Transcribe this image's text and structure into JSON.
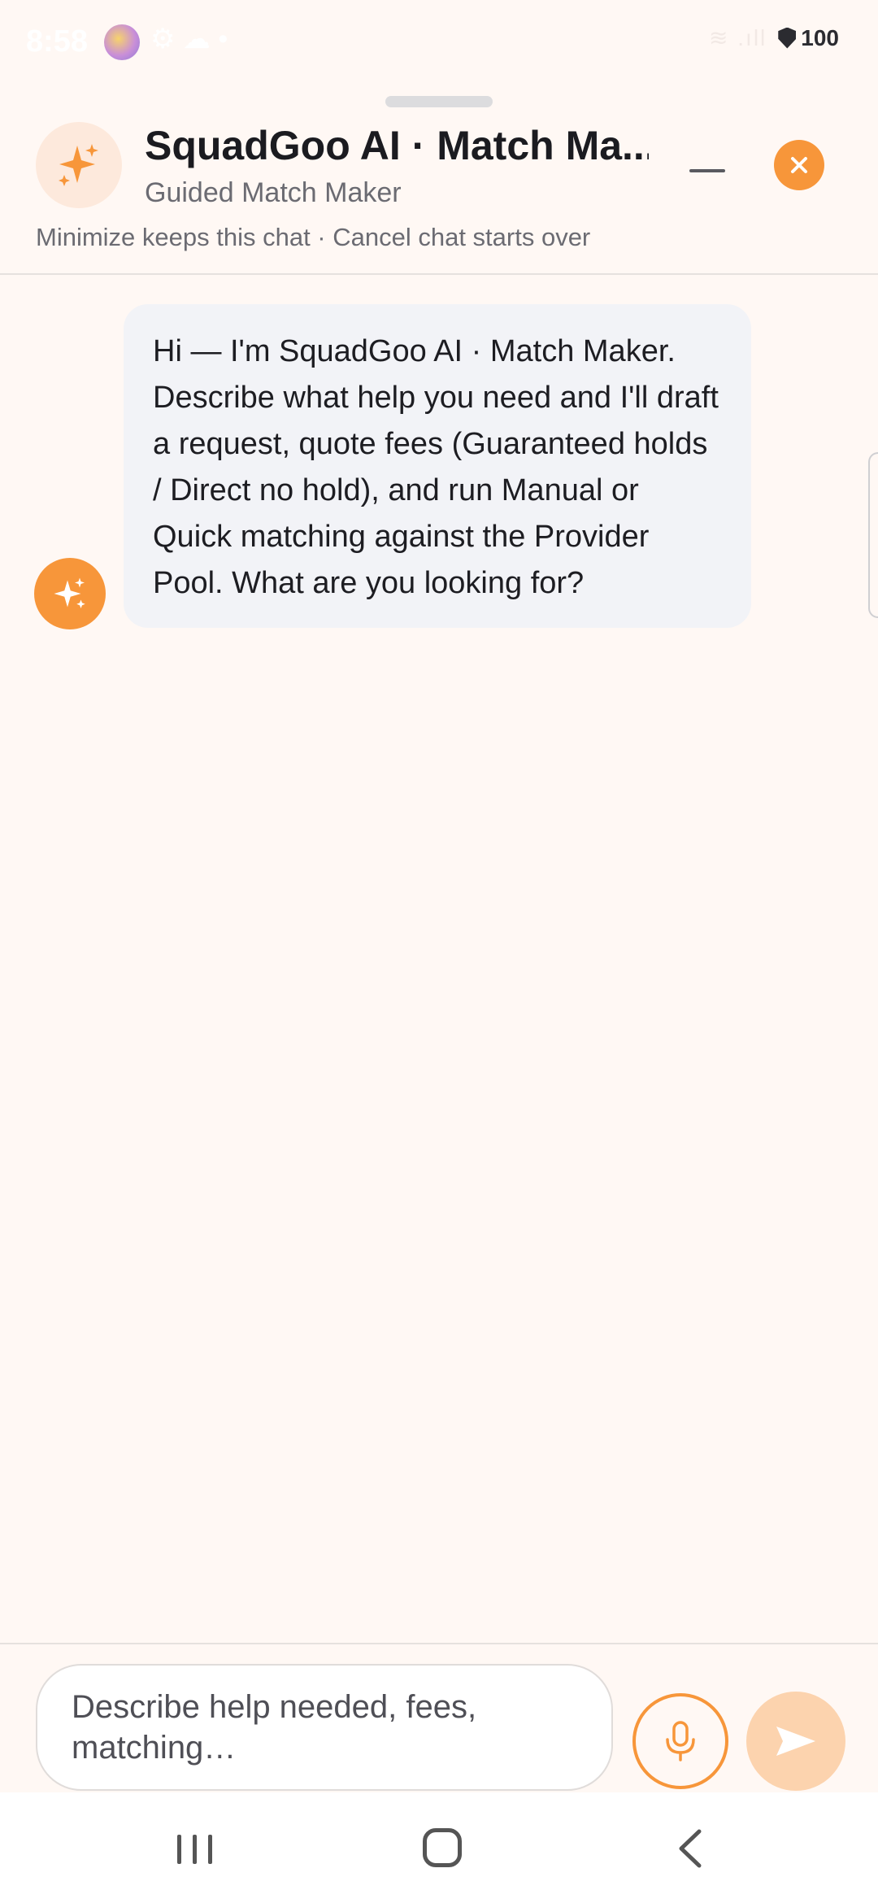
{
  "status_bar": {
    "time": "8:58",
    "misc_icons": "⚙ ☁ •",
    "signal": "≋ .ıll",
    "battery": "100"
  },
  "header": {
    "title": "SquadGoo AI · Match Ma...",
    "subtitle": "Guided Match Maker",
    "hint": "Minimize keeps this chat · Cancel chat starts over",
    "avatar_icon": "sparkles-icon",
    "minimize_icon": "minimize-icon",
    "close_icon": "close-icon"
  },
  "messages": [
    {
      "sender": "bot",
      "text": "Hi — I'm SquadGoo AI · Match Maker. Describe what help you need and I'll draft a request, quote fees (Guaranteed holds / Direct no hold), and run Manual or Quick matching against the Provider Pool. What are you looking for?"
    }
  ],
  "composer": {
    "placeholder": "Describe help needed, fees, matching…",
    "value": "",
    "mic_icon": "microphone-icon",
    "send_icon": "send-icon"
  },
  "nav_bar": {
    "recents_icon": "recents-icon",
    "home_icon": "home-icon",
    "back_icon": "back-icon"
  },
  "colors": {
    "accent": "#f7963a",
    "accent_light": "#fcd3ae",
    "background": "#fff8f4",
    "bubble": "#f2f3f7"
  }
}
